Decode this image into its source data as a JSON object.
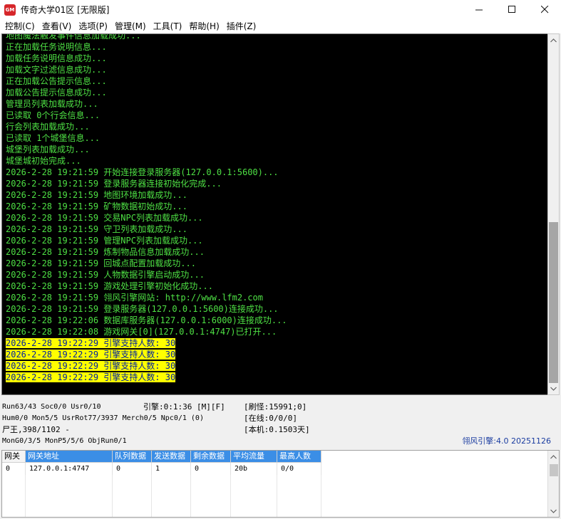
{
  "window": {
    "icon_label": "GM",
    "title": "传奇大学01区 [无限版]"
  },
  "menu": [
    "控制(C)",
    "查看(V)",
    "选项(P)",
    "管理(M)",
    "工具(T)",
    "帮助(H)",
    "插件(Z)"
  ],
  "console": {
    "lines": [
      "地图魔法触发事件信息加载成功...",
      "正在加载任务说明信息...",
      "加载任务说明信息成功...",
      "加载文字过滤信息成功...",
      "正在加载公告提示信息...",
      "加载公告提示信息成功...",
      "管理员列表加载成功...",
      "已读取 0个行会信息...",
      "行会列表加载成功...",
      "已读取 1个城堡信息...",
      "城堡列表加载成功...",
      "城堡城初始完成...",
      "2026-2-28 19:21:59 开始连接登录服务器(127.0.0.1:5600)...",
      "2026-2-28 19:21:59 登录服务器连接初始化完成...",
      "2026-2-28 19:21:59 地图环境加载成功...",
      "2026-2-28 19:21:59 矿物数据初始成功...",
      "2026-2-28 19:21:59 交易NPC列表加载成功...",
      "2026-2-28 19:21:59 守卫列表加载成功...",
      "2026-2-28 19:21:59 管理NPC列表加载成功...",
      "2026-2-28 19:21:59 炼制物品信息加载成功...",
      "2026-2-28 19:21:59 回城点配置加载成功...",
      "2026-2-28 19:21:59 人物数据引擎启动成功...",
      "2026-2-28 19:21:59 游戏处理引擎初始化成功...",
      "2026-2-28 19:21:59 翎风引擎网站: http://www.lfm2.com",
      "2026-2-28 19:21:59 登录服务器(127.0.0.1:5600)连接成功...",
      "2026-2-28 19:22:06 数据库服务器(127.0.0.1:6000)连接成功...",
      "2026-2-28 19:22:08 游戏网关[0](127.0.0.1:4747)已打开...",
      "2026-2-28 19:22:29 引擎支持人数: 30",
      "2026-2-28 19:22:29 引擎支持人数: 30",
      "2026-2-28 19:22:29 引擎支持人数: 30",
      "2026-2-28 19:22:29 引擎支持人数: 30"
    ],
    "highlighted_from_index": 27,
    "highlight_bg": "#ffff00",
    "text_color": "#4ee044"
  },
  "status": {
    "run": "Run63/43 Soc0/0 Usr0/10",
    "hum": "Hum0/0 Mon5/5 UsrRot77/3937 Merch0/5 Npc0/1 (0)",
    "corpse": "尸王,398/1102 -",
    "mong": "MonG0/3/5 MonP5/5/6 ObjRun0/1",
    "engine_time": "引擎:0:1:36 [M][F]",
    "refresh": "[刷怪:15991;0]",
    "online": "[在线:0/0/0]",
    "local": "[本机:0.1503天]",
    "engine_version": "翎风引擎:4.0 20251126"
  },
  "gateway_table": {
    "columns": [
      "网关",
      "网关地址",
      "队列数据",
      "发送数据",
      "剩余数据",
      "平均流量",
      "最高人数"
    ],
    "rows": [
      [
        "0",
        "127.0.0.1:4747",
        "0",
        "1",
        "0",
        "20b",
        "0/0"
      ]
    ]
  }
}
